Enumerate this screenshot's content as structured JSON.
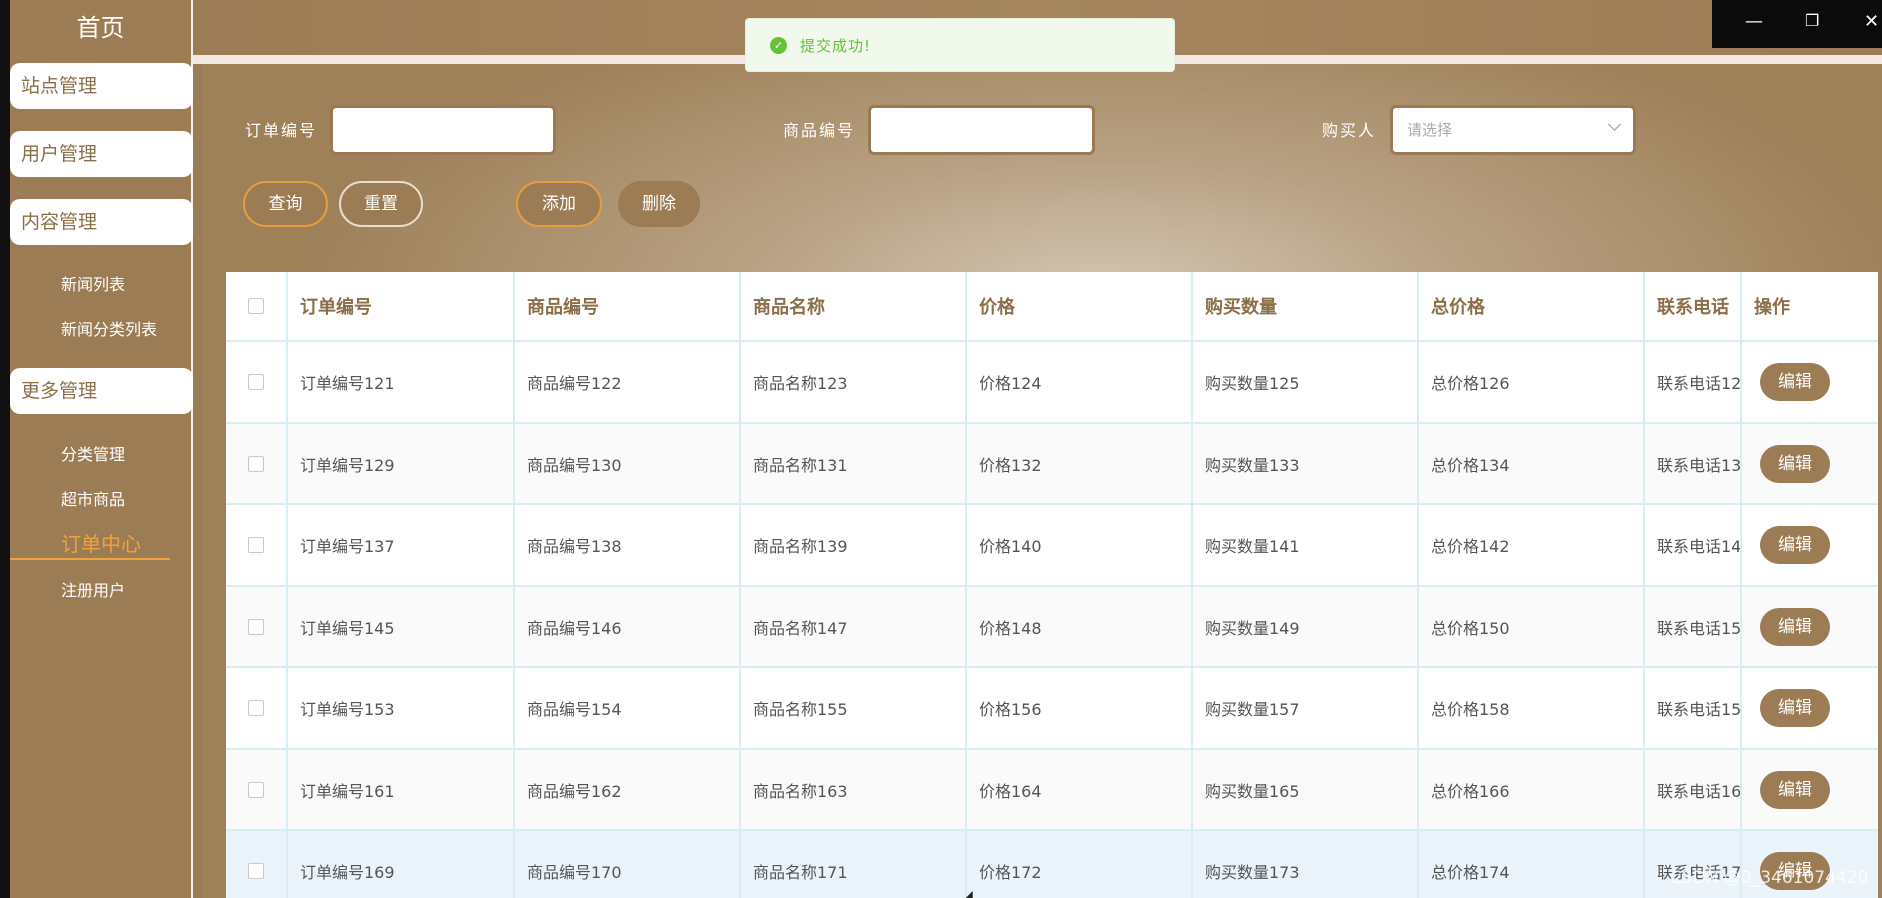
{
  "sidebar": {
    "home": "首页",
    "groups": [
      "站点管理",
      "用户管理",
      "内容管理",
      "更多管理"
    ],
    "content_items": [
      "新闻列表",
      "新闻分类列表"
    ],
    "more_items": [
      "分类管理",
      "超市商品",
      "订单中心",
      "注册用户"
    ],
    "active": "订单中心"
  },
  "toast": {
    "message": "提交成功!"
  },
  "search": {
    "order_no_label": "订单编号",
    "order_no_value": "",
    "product_no_label": "商品编号",
    "product_no_value": "",
    "buyer_label": "购买人",
    "buyer_placeholder": "请选择"
  },
  "buttons": {
    "query": "查询",
    "reset": "重置",
    "add": "添加",
    "delete": "删除"
  },
  "table": {
    "headers": [
      "订单编号",
      "商品编号",
      "商品名称",
      "价格",
      "购买数量",
      "总价格",
      "联系电话",
      "操作"
    ],
    "rows": [
      [
        "订单编号121",
        "商品编号122",
        "商品名称123",
        "价格124",
        "购买数量125",
        "总价格126",
        "联系电话12"
      ],
      [
        "订单编号129",
        "商品编号130",
        "商品名称131",
        "价格132",
        "购买数量133",
        "总价格134",
        "联系电话13"
      ],
      [
        "订单编号137",
        "商品编号138",
        "商品名称139",
        "价格140",
        "购买数量141",
        "总价格142",
        "联系电话14"
      ],
      [
        "订单编号145",
        "商品编号146",
        "商品名称147",
        "价格148",
        "购买数量149",
        "总价格150",
        "联系电话15"
      ],
      [
        "订单编号153",
        "商品编号154",
        "商品名称155",
        "价格156",
        "购买数量157",
        "总价格158",
        "联系电话15"
      ],
      [
        "订单编号161",
        "商品编号162",
        "商品名称163",
        "价格164",
        "购买数量165",
        "总价格166",
        "联系电话16"
      ],
      [
        "订单编号169",
        "商品编号170",
        "商品名称171",
        "价格172",
        "购买数量173",
        "总价格174",
        "联系电话17"
      ]
    ],
    "edit_label": "编辑"
  },
  "watermark": "CSDN @0_3461074420",
  "colors": {
    "primary": "#9c7c55",
    "accent": "#f0a23b",
    "success": "#67c23a"
  }
}
